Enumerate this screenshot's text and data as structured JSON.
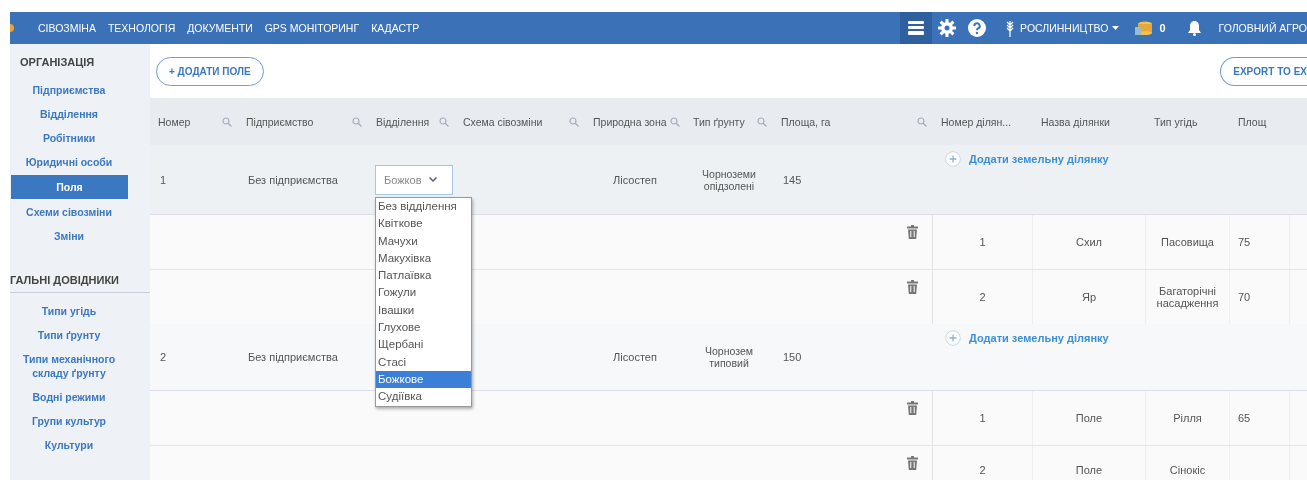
{
  "nav": {
    "items": [
      "СІВОЗМІНА",
      "ТЕХНОЛОГІЯ",
      "ДОКУМЕНТИ",
      "GPS МОНІТОРИНГ",
      "КАДАСТР"
    ],
    "crop": "РОСЛИННИЦТВО",
    "coins": "0",
    "user": "ГОЛОВНИЙ АГРО"
  },
  "sidebar": [
    {
      "title": "ОРГАНІЗАЦІЯ",
      "items": [
        {
          "label": "Підприємства",
          "selected": false
        },
        {
          "label": "Відділення",
          "selected": false
        },
        {
          "label": "Робітники",
          "selected": false
        },
        {
          "label": "Юридичні особи",
          "selected": false
        },
        {
          "label": "Поля",
          "selected": true
        },
        {
          "label": "Схеми сівозміни",
          "selected": false
        },
        {
          "label": "Зміни",
          "selected": false
        }
      ]
    },
    {
      "title": "ГАЛЬНІ ДОВІДНИКИ",
      "items": [
        {
          "label": "Типи угідь",
          "selected": false
        },
        {
          "label": "Типи ґрунту",
          "selected": false
        },
        {
          "label": "Типи механічного складу ґрунту",
          "selected": false
        },
        {
          "label": "Водні режими",
          "selected": false
        },
        {
          "label": "Групи культур",
          "selected": false
        },
        {
          "label": "Культури",
          "selected": false
        }
      ]
    }
  ],
  "toolbar": {
    "add_button": "+ ДОДАТИ ПОЛЕ",
    "export_button": "EXPORT TO EX"
  },
  "columns": [
    {
      "label": "Номер",
      "searchable": true
    },
    {
      "label": "Підприємство",
      "searchable": true
    },
    {
      "label": "Відділення",
      "searchable": true
    },
    {
      "label": "Схема сівозміни",
      "searchable": true
    },
    {
      "label": "Природна зона",
      "searchable": true
    },
    {
      "label": "Тип ґрунту",
      "searchable": true
    },
    {
      "label": "Площа, га",
      "searchable": true
    },
    {
      "label": "Номер ділян...",
      "searchable": false
    },
    {
      "label": "Назва ділянки",
      "searchable": false
    },
    {
      "label": "Тип угідь",
      "searchable": false
    },
    {
      "label": "Площ",
      "searchable": false
    }
  ],
  "fields": [
    {
      "number": "1",
      "enterprise": "Без підприємства",
      "division": {
        "value": "Божков",
        "open": true,
        "options": [
          {
            "label": "Без відділення",
            "selected": false
          },
          {
            "label": "Квіткове",
            "selected": false
          },
          {
            "label": "Мачухи",
            "selected": false
          },
          {
            "label": "Макухівка",
            "selected": false
          },
          {
            "label": "Патлаївка",
            "selected": false
          },
          {
            "label": "Гожули",
            "selected": false
          },
          {
            "label": "Івашки",
            "selected": false
          },
          {
            "label": "Глухове",
            "selected": false
          },
          {
            "label": "Щербані",
            "selected": false
          },
          {
            "label": "Стасі",
            "selected": false
          },
          {
            "label": "Божкове",
            "selected": true
          },
          {
            "label": "Судіївка",
            "selected": false
          }
        ]
      },
      "zone": "Лісостеп",
      "soil": "Чорноземи опідзолені",
      "area": "145",
      "add_parcel": "Додати земельну ділянку",
      "parcels": [
        {
          "number": "1",
          "name": "Схил",
          "land_type": "Пасовища",
          "area": "75"
        },
        {
          "number": "2",
          "name": "Яр",
          "land_type": "Багаторічні насадження",
          "area": "70"
        }
      ]
    },
    {
      "number": "2",
      "enterprise": "Без підприємства",
      "zone": "Лісостеп",
      "soil": "Чорнозем типовий",
      "area": "150",
      "add_parcel": "Додати земельну ділянку",
      "parcels": [
        {
          "number": "1",
          "name": "Поле",
          "land_type": "Рілля",
          "area": "65"
        },
        {
          "number": "2",
          "name": "Поле",
          "land_type": "Сінокіс"
        }
      ]
    }
  ]
}
